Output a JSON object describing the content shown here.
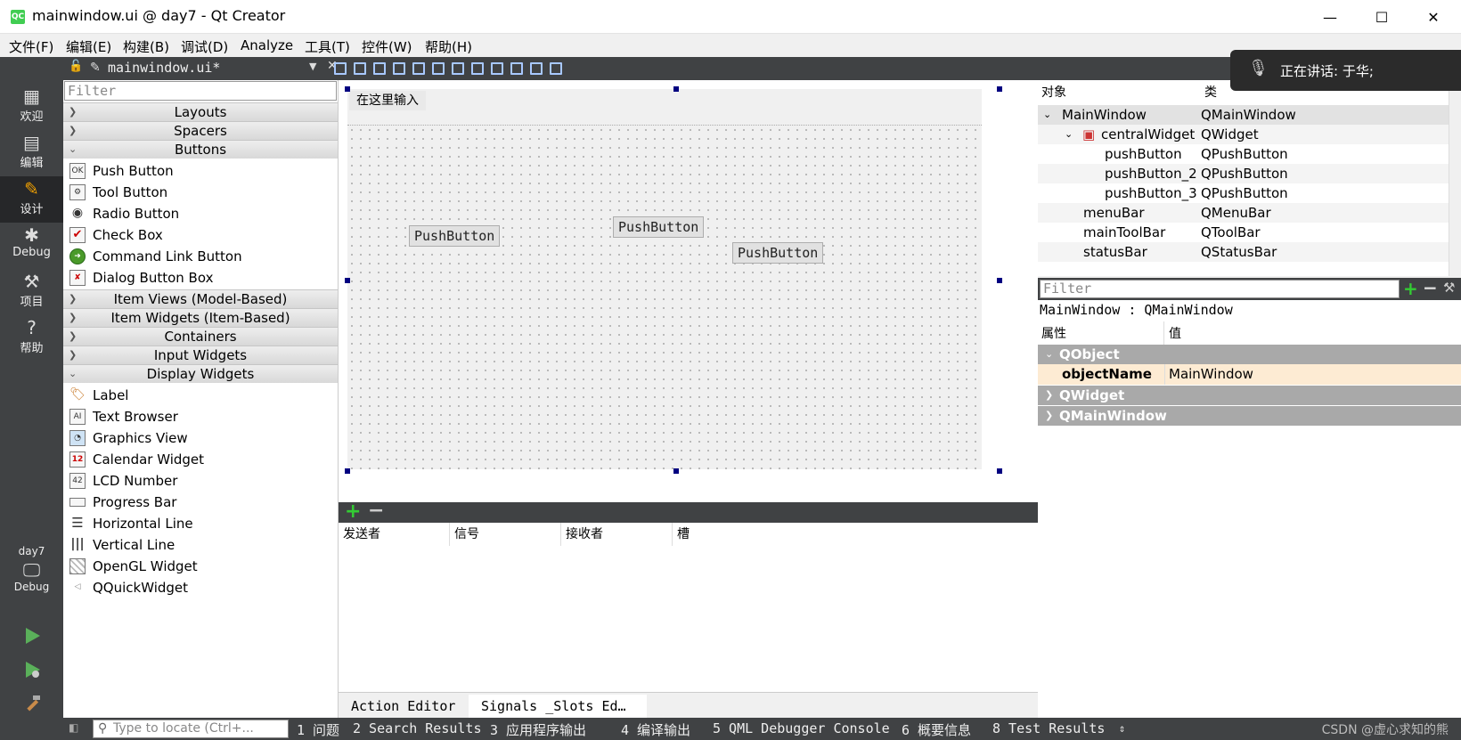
{
  "window": {
    "title": "mainwindow.ui @ day7 - Qt Creator",
    "app_icon": "QC",
    "minimize": "—",
    "maximize": "☐",
    "close": "✕"
  },
  "menubar": [
    "文件(F)",
    "编辑(E)",
    "构建(B)",
    "调试(D)",
    "Analyze",
    "工具(T)",
    "控件(W)",
    "帮助(H)"
  ],
  "modes": [
    {
      "label": "欢迎",
      "icon": "grid-icon"
    },
    {
      "label": "编辑",
      "icon": "document-icon"
    },
    {
      "label": "设计",
      "icon": "pencil-icon"
    },
    {
      "label": "Debug",
      "icon": "bug-icon"
    },
    {
      "label": "项目",
      "icon": "wrench-icon"
    },
    {
      "label": "帮助",
      "icon": "help-icon"
    }
  ],
  "kit": {
    "project": "day7",
    "config": "Debug"
  },
  "editor_doc": {
    "name": "mainwindow.ui*"
  },
  "widgetbox": {
    "filter_placeholder": "Filter",
    "categories": {
      "layouts": "Layouts",
      "spacers": "Spacers",
      "buttons": "Buttons",
      "item_views": "Item Views (Model-Based)",
      "item_widgets": "Item Widgets (Item-Based)",
      "containers": "Containers",
      "input_widgets": "Input Widgets",
      "display_widgets": "Display Widgets"
    },
    "buttons": [
      "Push Button",
      "Tool Button",
      "Radio Button",
      "Check Box",
      "Command Link Button",
      "Dialog Button Box"
    ],
    "display": [
      "Label",
      "Text Browser",
      "Graphics View",
      "Calendar Widget",
      "LCD Number",
      "Progress Bar",
      "Horizontal Line",
      "Vertical Line",
      "OpenGL Widget",
      "QQuickWidget"
    ]
  },
  "form": {
    "menu_placeholder": "在这里输入",
    "buttons": [
      "PushButton",
      "PushButton",
      "PushButton"
    ]
  },
  "signals": {
    "headers": [
      "发送者",
      "信号",
      "接收者",
      "槽"
    ]
  },
  "bottom_tabs": [
    "Action Editor",
    "Signals _Slots Ed…"
  ],
  "object_inspector": {
    "headers": [
      "对象",
      "类"
    ],
    "rows": [
      {
        "name": "MainWindow",
        "class": "QMainWindow"
      },
      {
        "name": "centralWidget",
        "class": "QWidget"
      },
      {
        "name": "pushButton",
        "class": "QPushButton"
      },
      {
        "name": "pushButton_2",
        "class": "QPushButton"
      },
      {
        "name": "pushButton_3",
        "class": "QPushButton"
      },
      {
        "name": "menuBar",
        "class": "QMenuBar"
      },
      {
        "name": "mainToolBar",
        "class": "QToolBar"
      },
      {
        "name": "statusBar",
        "class": "QStatusBar"
      }
    ]
  },
  "property_editor": {
    "filter_placeholder": "Filter",
    "class_line": "MainWindow : QMainWindow",
    "headers": [
      "属性",
      "值"
    ],
    "groups": [
      "QObject",
      "QWidget",
      "QMainWindow"
    ],
    "prop_name": "objectName",
    "prop_value": "MainWindow"
  },
  "statusbar": {
    "locator_placeholder": "Type to locate (Ctrl+...",
    "tabs": [
      "1 问题",
      "2 Search Results",
      "3 应用程序输出",
      "4 编译输出",
      "5 QML Debugger Console",
      "6 概要信息",
      "8 Test Results"
    ],
    "watermark": "CSDN @虚心求知的熊"
  },
  "notification": {
    "text": "正在讲话: 于华;"
  },
  "colors": {
    "dark": "#404244",
    "selection_handle": "#000080",
    "group_header": "#a9a9a9",
    "prop_highlight": "#fdebd3"
  }
}
